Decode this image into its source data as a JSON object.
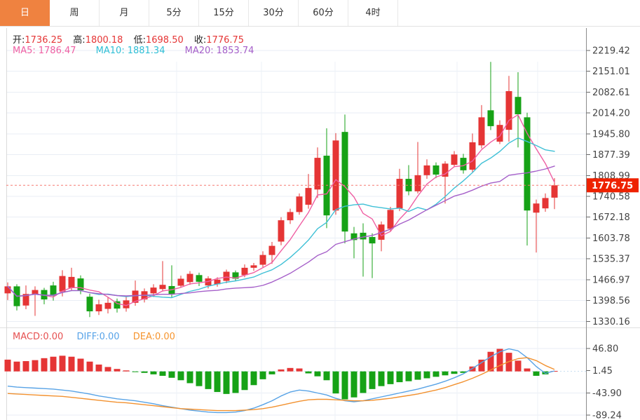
{
  "tabs": [
    {
      "key": "day",
      "label": "日",
      "active": true
    },
    {
      "key": "week",
      "label": "周",
      "active": false
    },
    {
      "key": "month",
      "label": "月",
      "active": false
    },
    {
      "key": "5min",
      "label": "5分",
      "active": false
    },
    {
      "key": "15min",
      "label": "15分",
      "active": false
    },
    {
      "key": "30min",
      "label": "30分",
      "active": false
    },
    {
      "key": "60min",
      "label": "60分",
      "active": false
    },
    {
      "key": "4hour",
      "label": "4时",
      "active": false
    }
  ],
  "ohlc": {
    "open_label": "开:",
    "open": "1736.25",
    "high_label": "高:",
    "high": "1800.18",
    "low_label": "低:",
    "low": "1698.50",
    "close_label": "收:",
    "close": "1776.75"
  },
  "ma": {
    "ma5_label": "MA5:",
    "ma5": "1786.47",
    "ma10_label": "MA10:",
    "ma10": "1881.34",
    "ma20_label": "MA20:",
    "ma20": "1853.74"
  },
  "macd_header": {
    "macd_label": "MACD:",
    "macd": "0.00",
    "diff_label": "DIFF:",
    "diff": "0.00",
    "dea_label": "DEA:",
    "dea": "0.00"
  },
  "price_tag": "1776.75",
  "colors": {
    "up": "#e53535",
    "down": "#16a216",
    "ma5": "#ef5fa3",
    "ma10": "#3fc0d6",
    "ma20": "#a55fc9",
    "diff_line": "#58a3e6",
    "dea_line": "#f2912f",
    "active_tab": "#ef8240",
    "tag_bg": "#ee2200",
    "dashed_price": "#f57a72",
    "grid": "#e9eef5",
    "axis": "#8c8c8c",
    "axis_text": "#444444"
  },
  "chart_data": {
    "type": "candlestick",
    "title": "",
    "xlabel": "",
    "ylabel": "",
    "price_axis_ticks": [
      "2219.42",
      "2151.01",
      "2082.61",
      "2014.20",
      "1945.80",
      "1877.39",
      "1808.99",
      "1740.58",
      "1672.18",
      "1603.78",
      "1535.37",
      "1466.97",
      "1398.56",
      "1330.16"
    ],
    "macd_axis_ticks": [
      "46.80",
      "1.45",
      "-43.90",
      "-89.24"
    ],
    "last_price": 1776.75,
    "ma_periods": [
      5,
      10,
      20
    ],
    "ma_values": {
      "ma5": 1786.47,
      "ma10": 1881.34,
      "ma20": 1853.74
    },
    "candles_ohlc": [
      [
        1422,
        1458,
        1400,
        1445
      ],
      [
        1445,
        1452,
        1366,
        1380
      ],
      [
        1382,
        1448,
        1370,
        1420
      ],
      [
        1420,
        1445,
        1348,
        1433
      ],
      [
        1433,
        1440,
        1386,
        1402
      ],
      [
        1448,
        1460,
        1398,
        1414
      ],
      [
        1428,
        1498,
        1412,
        1479
      ],
      [
        1440,
        1506,
        1431,
        1476
      ],
      [
        1471,
        1481,
        1419,
        1432
      ],
      [
        1411,
        1421,
        1344,
        1363
      ],
      [
        1363,
        1401,
        1351,
        1386
      ],
      [
        1371,
        1410,
        1356,
        1391
      ],
      [
        1396,
        1405,
        1359,
        1372
      ],
      [
        1373,
        1413,
        1362,
        1399
      ],
      [
        1391,
        1464,
        1381,
        1431
      ],
      [
        1402,
        1438,
        1392,
        1429
      ],
      [
        1422,
        1452,
        1410,
        1441
      ],
      [
        1436,
        1528,
        1428,
        1450
      ],
      [
        1446,
        1514,
        1408,
        1418
      ],
      [
        1447,
        1480,
        1440,
        1470
      ],
      [
        1459,
        1495,
        1450,
        1486
      ],
      [
        1482,
        1490,
        1446,
        1460
      ],
      [
        1448,
        1478,
        1438,
        1471
      ],
      [
        1452,
        1475,
        1444,
        1467
      ],
      [
        1463,
        1500,
        1455,
        1493
      ],
      [
        1491,
        1497,
        1462,
        1470
      ],
      [
        1482,
        1517,
        1475,
        1506
      ],
      [
        1506,
        1522,
        1496,
        1514
      ],
      [
        1516,
        1560,
        1508,
        1548
      ],
      [
        1548,
        1591,
        1519,
        1578
      ],
      [
        1592,
        1672,
        1580,
        1662
      ],
      [
        1662,
        1700,
        1650,
        1689
      ],
      [
        1689,
        1750,
        1680,
        1740
      ],
      [
        1713,
        1814,
        1700,
        1768
      ],
      [
        1763,
        1901,
        1735,
        1867
      ],
      [
        1874,
        1964,
        1636,
        1678
      ],
      [
        1694,
        1948,
        1680,
        1924
      ],
      [
        1952,
        2009,
        1586,
        1625
      ],
      [
        1619,
        1640,
        1537,
        1597
      ],
      [
        1621,
        1652,
        1477,
        1599
      ],
      [
        1607,
        1619,
        1472,
        1586
      ],
      [
        1598,
        1658,
        1560,
        1648
      ],
      [
        1634,
        1706,
        1626,
        1696
      ],
      [
        1701,
        1831,
        1692,
        1798
      ],
      [
        1798,
        1843,
        1744,
        1757
      ],
      [
        1757,
        1919,
        1750,
        1810
      ],
      [
        1810,
        1862,
        1798,
        1842
      ],
      [
        1842,
        1852,
        1800,
        1812
      ],
      [
        1805,
        1856,
        1717,
        1848
      ],
      [
        1844,
        1889,
        1836,
        1878
      ],
      [
        1867,
        1880,
        1815,
        1826
      ],
      [
        1828,
        1947,
        1820,
        1918
      ],
      [
        1908,
        2040,
        1898,
        2000
      ],
      [
        2023,
        2182,
        1958,
        1971
      ],
      [
        1920,
        1990,
        1912,
        1975
      ],
      [
        1959,
        2136,
        1920,
        2086
      ],
      [
        2067,
        2148,
        1901,
        2010
      ],
      [
        2000,
        2015,
        1579,
        1694
      ],
      [
        1687,
        1730,
        1556,
        1717
      ],
      [
        1701,
        1750,
        1690,
        1735
      ],
      [
        1736.25,
        1800.18,
        1698.5,
        1776.75
      ]
    ],
    "macd_hist": [
      24,
      20,
      21,
      23,
      27,
      30,
      32,
      30,
      26,
      20,
      14,
      9,
      5,
      2,
      -1,
      -3,
      -6,
      -9,
      -13,
      -18,
      -24,
      -30,
      -36,
      -42,
      -46,
      -44,
      -38,
      -28,
      -16,
      -6,
      4,
      7,
      6,
      -4,
      -10,
      -18,
      -45,
      -57,
      -53,
      -44,
      -36,
      -30,
      -26,
      -22,
      -20,
      -17,
      -14,
      -11,
      -8,
      -5,
      -3,
      10,
      24,
      40,
      46,
      38,
      22,
      6,
      -9,
      -6,
      1
    ],
    "macd_diff": [
      -30,
      -32,
      -33,
      -34,
      -35,
      -36,
      -38,
      -40,
      -43,
      -46,
      -50,
      -53,
      -56,
      -58,
      -60,
      -63,
      -66,
      -70,
      -73,
      -76,
      -79,
      -81,
      -83,
      -84,
      -84,
      -83,
      -80,
      -75,
      -68,
      -60,
      -50,
      -42,
      -38,
      -40,
      -44,
      -48,
      -55,
      -60,
      -62,
      -60,
      -56,
      -52,
      -48,
      -44,
      -40,
      -36,
      -31,
      -26,
      -20,
      -13,
      -5,
      6,
      18,
      30,
      40,
      46,
      42,
      28,
      10,
      -4,
      1
    ],
    "macd_dea": [
      -45,
      -46,
      -47,
      -48,
      -49,
      -50,
      -51,
      -53,
      -55,
      -57,
      -59,
      -61,
      -63,
      -64,
      -66,
      -68,
      -70,
      -72,
      -74,
      -76,
      -77,
      -78,
      -79,
      -80,
      -80,
      -80,
      -79,
      -78,
      -76,
      -73,
      -69,
      -65,
      -61,
      -58,
      -57,
      -57,
      -58,
      -59,
      -60,
      -60,
      -59,
      -57,
      -55,
      -52,
      -49,
      -46,
      -42,
      -38,
      -33,
      -27,
      -21,
      -14,
      -6,
      3,
      12,
      20,
      26,
      28,
      22,
      12,
      4
    ]
  }
}
